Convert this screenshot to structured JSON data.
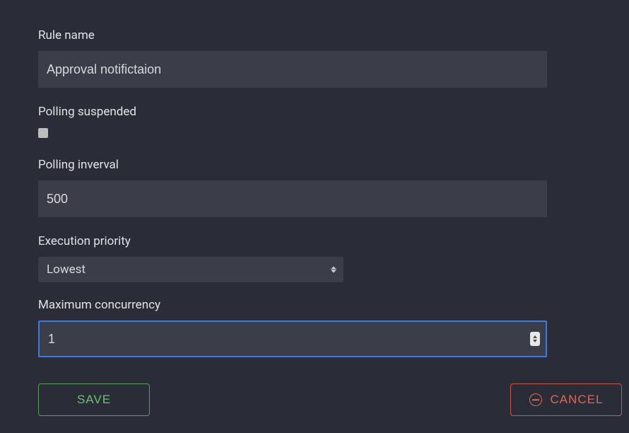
{
  "fields": {
    "rule_name": {
      "label": "Rule name",
      "value": "Approval notifictaion"
    },
    "polling_suspended": {
      "label": "Polling suspended",
      "checked": false
    },
    "polling_interval": {
      "label": "Polling inverval",
      "value": "500"
    },
    "execution_priority": {
      "label": "Execution priority",
      "value": "Lowest"
    },
    "max_concurrency": {
      "label": "Maximum concurrency",
      "value": "1"
    }
  },
  "actions": {
    "save": "SAVE",
    "cancel": "CANCEL"
  }
}
